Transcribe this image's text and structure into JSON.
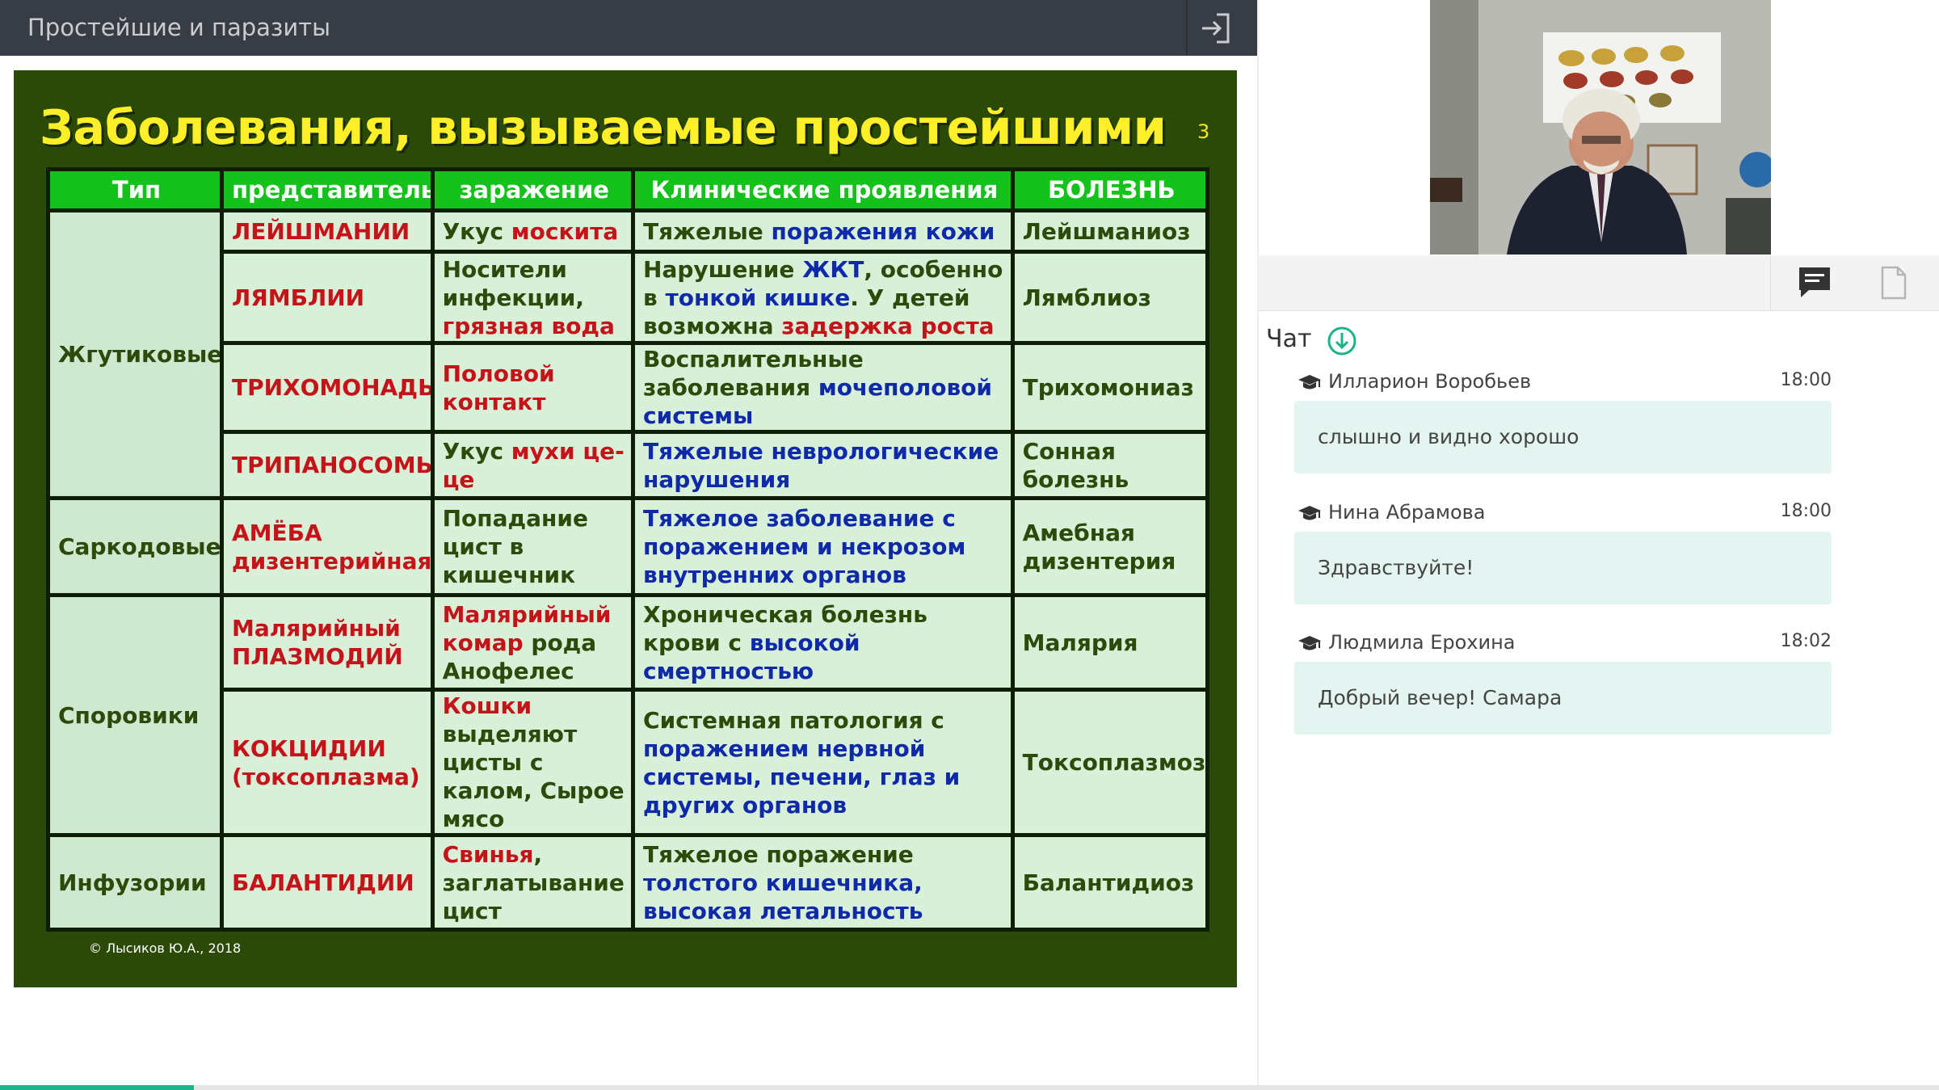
{
  "header": {
    "title": "Простейшие и паразиты",
    "exit_icon": "exit-icon"
  },
  "slide": {
    "title": "Заболевания, вызываемые простейшими",
    "page_number": "3",
    "copyright": "© Лысиков Ю.А., 2018",
    "columns": [
      "Тип",
      "представитель",
      "заражение",
      "Клинические проявления",
      "БОЛЕЗНЬ"
    ],
    "types": [
      "Жгутиковые",
      "Саркодовые",
      "Споровики",
      "Инфузории"
    ],
    "rows": [
      {
        "representative": "ЛЕЙШМАНИИ",
        "infection": [
          {
            "t": "Укус ",
            "c": "dk"
          },
          {
            "t": "москита",
            "c": "red"
          }
        ],
        "clinical": [
          {
            "t": "Тяжелые ",
            "c": "dk"
          },
          {
            "t": "поражения кожи",
            "c": "blue"
          }
        ],
        "disease": "Лейшманиоз"
      },
      {
        "representative": "ЛЯМБЛИИ",
        "infection": [
          {
            "t": "Носители инфекции, ",
            "c": "dk"
          },
          {
            "t": "грязная вода",
            "c": "red"
          }
        ],
        "clinical": [
          {
            "t": "Нарушение ",
            "c": "dk"
          },
          {
            "t": "ЖКТ",
            "c": "blue"
          },
          {
            "t": ", особенно в ",
            "c": "dk"
          },
          {
            "t": "тонкой кишке",
            "c": "blue"
          },
          {
            "t": ". У детей возможна ",
            "c": "dk"
          },
          {
            "t": "задержка роста",
            "c": "red"
          }
        ],
        "disease": "Лямблиоз"
      },
      {
        "representative": "ТРИХОМОНАДЫ",
        "infection": [
          {
            "t": "Половой контакт",
            "c": "red"
          }
        ],
        "clinical": [
          {
            "t": "Воспалительные заболевания ",
            "c": "dk"
          },
          {
            "t": "мочеполовой системы",
            "c": "blue"
          }
        ],
        "disease": "Трихомониаз"
      },
      {
        "representative": "ТРИПАНОСОМЫ",
        "infection": [
          {
            "t": "Укус ",
            "c": "dk"
          },
          {
            "t": "мухи це-це",
            "c": "red"
          }
        ],
        "clinical": [
          {
            "t": "Тяжелые неврологические нарушения",
            "c": "blue"
          }
        ],
        "disease": "Сонная болезнь"
      },
      {
        "representative": "АМЁБА дизентерийная",
        "infection": [
          {
            "t": "Попадание цист в кишечник",
            "c": "dk"
          }
        ],
        "clinical": [
          {
            "t": "Тяжелое заболевание с поражением и некрозом внутренних органов",
            "c": "blue"
          }
        ],
        "disease": "Амебная дизентерия"
      },
      {
        "representative": "Малярийный ПЛАЗМОДИЙ",
        "infection": [
          {
            "t": "Малярийный комар ",
            "c": "red"
          },
          {
            "t": "рода Анофелес",
            "c": "dk"
          }
        ],
        "clinical": [
          {
            "t": "Хроническая болезнь крови с ",
            "c": "dk"
          },
          {
            "t": "высокой смертностью",
            "c": "blue"
          }
        ],
        "disease": "Малярия"
      },
      {
        "representative": "КОКЦИДИИ (токсоплазма)",
        "infection": [
          {
            "t": "Кошки ",
            "c": "red"
          },
          {
            "t": "выделяют цисты с калом, Сырое мясо",
            "c": "dk"
          }
        ],
        "clinical": [
          {
            "t": "Системная патология с ",
            "c": "dk"
          },
          {
            "t": "поражением нервной системы, печени, глаз и других органов",
            "c": "blue"
          }
        ],
        "disease": "Токсоплазмоз"
      },
      {
        "representative": "БАЛАНТИДИИ",
        "infection": [
          {
            "t": "Свинья",
            "c": "red"
          },
          {
            "t": ", заглатывание цист",
            "c": "dk"
          }
        ],
        "clinical": [
          {
            "t": "Тяжелое поражение ",
            "c": "dk"
          },
          {
            "t": "толстого кишечника, высокая летальность",
            "c": "blue"
          }
        ],
        "disease": "Балантидиоз"
      }
    ]
  },
  "toolbar": {
    "chat_icon": "chat-icon",
    "document_icon": "document-icon"
  },
  "chat": {
    "title": "Чат",
    "messages": [
      {
        "author": "Илларион Воробьев",
        "time": "18:00",
        "text": "слышно и видно хорошо"
      },
      {
        "author": "Нина Абрамова",
        "time": "18:00",
        "text": "Здравствуйте!"
      },
      {
        "author": "Людмила Ерохина",
        "time": "18:02",
        "text": "Добрый вечер! Самара"
      }
    ]
  },
  "colors": {
    "topbar": "#383d45",
    "slide_bg": "#2b4a07",
    "slide_title": "#ffef28",
    "table_header": "#14c21b",
    "cell_bg": "#d9f0d8",
    "text_red": "#c5131a",
    "text_blue": "#0f2aa8",
    "text_green": "#2d4a0b",
    "chat_bubble": "#e4f5f1",
    "accent": "#19b48a"
  }
}
